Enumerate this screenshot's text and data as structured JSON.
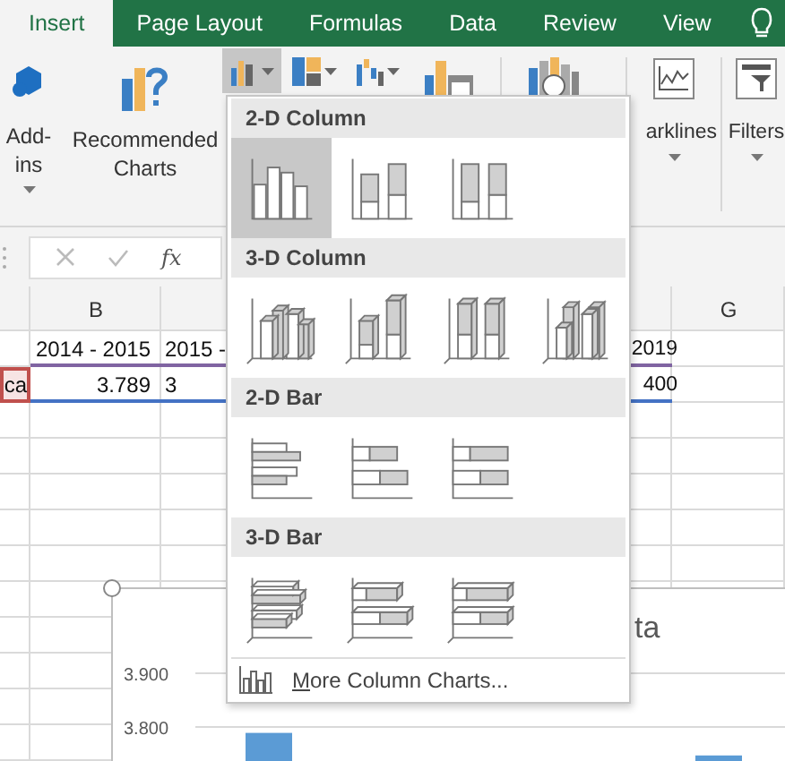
{
  "tabs": [
    {
      "label": "Insert",
      "selected": true
    },
    {
      "label": "Page Layout",
      "selected": false
    },
    {
      "label": "Formulas",
      "selected": false
    },
    {
      "label": "Data",
      "selected": false
    },
    {
      "label": "Review",
      "selected": false
    },
    {
      "label": "View",
      "selected": false
    }
  ],
  "ribbon": [
    {
      "kind": "add-ins",
      "lines": [
        "Add-",
        "ins"
      ],
      "dropdown": true
    },
    {
      "kind": "recommended-charts",
      "lines": [
        "Recommended",
        "Charts"
      ],
      "dropdown": false
    },
    {
      "kind": "sparklines",
      "lines": [
        "arklines"
      ],
      "dropdown": true
    },
    {
      "kind": "filters",
      "lines": [
        "Filters"
      ],
      "dropdown": true
    }
  ],
  "chart_buttons": [
    {
      "kind": "column",
      "selected": true,
      "dropdown": true
    },
    {
      "kind": "hierarchy",
      "selected": false,
      "dropdown": true
    },
    {
      "kind": "waterfall",
      "selected": false,
      "dropdown": true
    }
  ],
  "formula_bar": {
    "function_label": "fx"
  },
  "sheet": {
    "headers": {
      "B": "B",
      "G": "G"
    },
    "rows": [
      {
        "color": "#8064a2",
        "cells": {
          "B": {
            "text": "2014 - 2015"
          },
          "C": {
            "text": "2015 -"
          },
          "F": {
            "text": "2019"
          }
        }
      },
      {
        "color": "#4472c4",
        "cells": {
          "A": {
            "text": "ca",
            "color": "#c0504d"
          },
          "B": {
            "text": "3.789"
          },
          "C": {
            "text": "3"
          },
          "F": {
            "text": "400"
          }
        }
      }
    ]
  },
  "chart": {
    "chart_data": {
      "type": "bar",
      "title": "ta",
      "ylim": [
        3.7,
        3.9
      ],
      "yticks": [
        {
          "value": 3.8,
          "label": "3.800"
        },
        {
          "value": 3.9,
          "label": "3.900"
        }
      ],
      "values": [
        3.789,
        3.747
      ]
    }
  },
  "gallery": {
    "sections": [
      {
        "title": "2-D Column",
        "items": [
          {
            "kind": "column-clustered",
            "selected": true
          },
          {
            "kind": "column-stacked",
            "selected": false
          },
          {
            "kind": "column-100",
            "selected": false
          }
        ]
      },
      {
        "title": "3-D Column",
        "items": [
          {
            "kind": "column3d-clustered",
            "selected": false
          },
          {
            "kind": "column3d-stacked",
            "selected": false
          },
          {
            "kind": "column3d-100",
            "selected": false
          },
          {
            "kind": "column3d",
            "selected": false
          }
        ]
      },
      {
        "title": "2-D Bar",
        "items": [
          {
            "kind": "bar-clustered",
            "selected": false
          },
          {
            "kind": "bar-stacked",
            "selected": false
          },
          {
            "kind": "bar-100",
            "selected": false
          }
        ]
      },
      {
        "title": "3-D Bar",
        "items": [
          {
            "kind": "bar3d-clustered",
            "selected": false
          },
          {
            "kind": "bar3d-stacked",
            "selected": false
          },
          {
            "kind": "bar3d-100",
            "selected": false
          }
        ]
      }
    ],
    "more": "More Column Charts..."
  }
}
